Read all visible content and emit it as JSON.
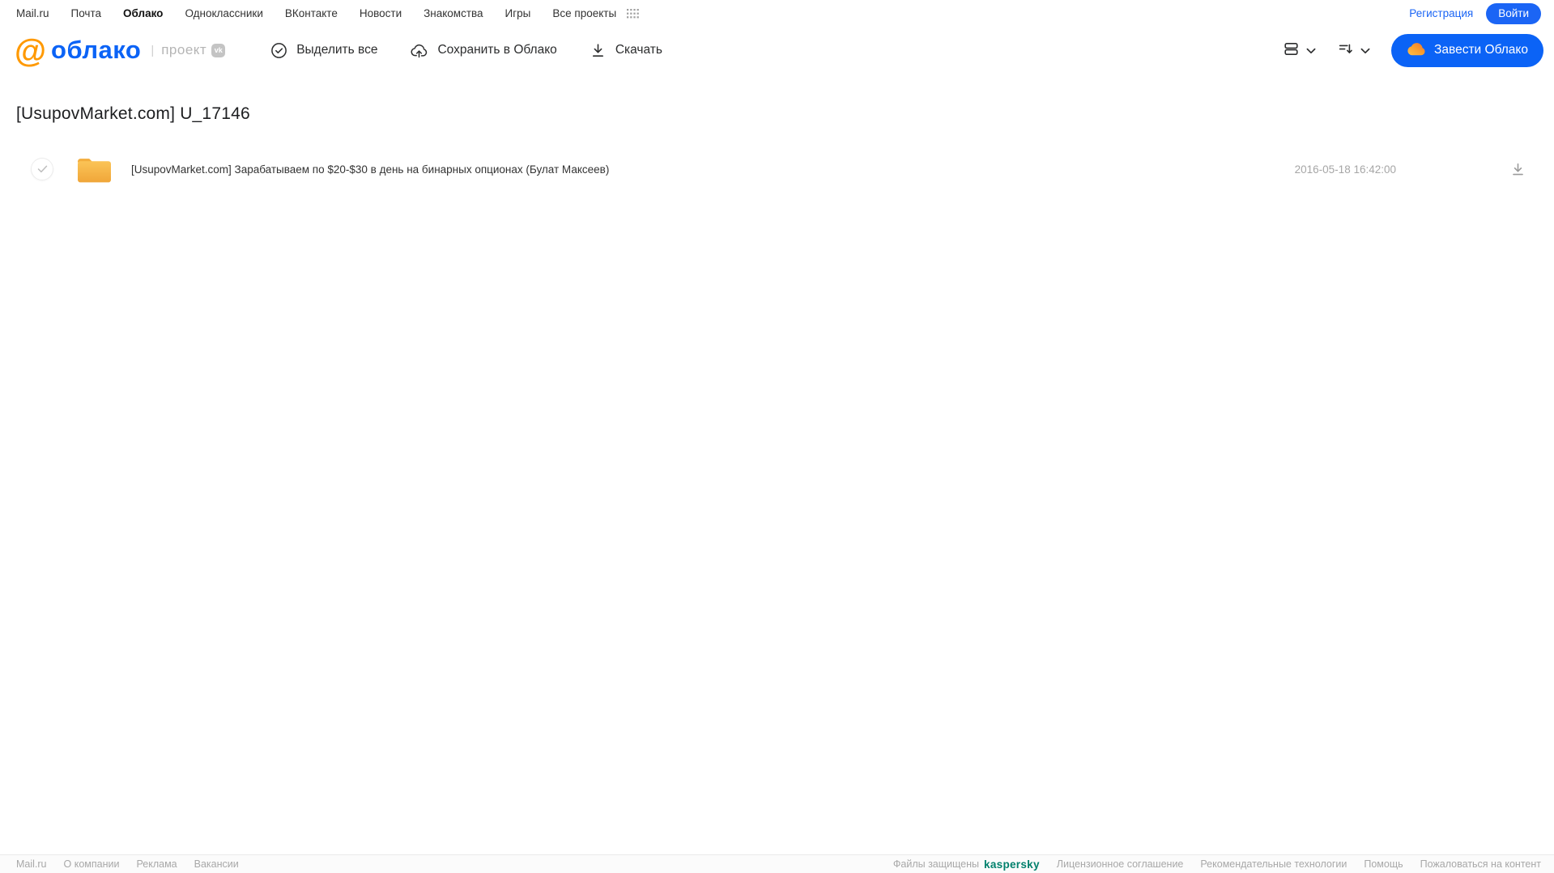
{
  "topnav": {
    "items": [
      "Mail.ru",
      "Почта",
      "Облако",
      "Одноклассники",
      "ВКонтакте",
      "Новости",
      "Знакомства",
      "Игры",
      "Все проекты"
    ],
    "active_item": "Облако",
    "registration_label": "Регистрация",
    "login_label": "Войти"
  },
  "header": {
    "logo_at": "@",
    "logo_text": "облако",
    "project_label": "проект",
    "vk_badge": "vk",
    "toolbar": {
      "select_all_label": "Выделить все",
      "save_to_cloud_label": "Сохранить в Облако",
      "download_label": "Скачать"
    },
    "get_cloud_label": "Завести Облако"
  },
  "main": {
    "title": "[UsupovMarket.com] U_17146",
    "files": [
      {
        "type": "folder",
        "name": "[UsupovMarket.com] Зарабатываем по $20-$30 в день на бинарных опционах (Булат Максеев)",
        "date": "2016-05-18 16:42:00"
      }
    ]
  },
  "footer": {
    "left_links": [
      "Mail.ru",
      "О компании",
      "Реклама",
      "Вакансии"
    ],
    "protected_label": "Файлы защищены",
    "kaspersky_label": "kaspersky",
    "right_links": [
      "Лицензионное соглашение",
      "Рекомендательные технологии",
      "Помощь",
      "Пожаловаться на контент"
    ]
  },
  "colors": {
    "accent_blue": "#0b63f6",
    "link_blue": "#1b65f5",
    "logo_orange": "#ff9900",
    "folder_yellow": "#f5b13c",
    "kaspersky_teal": "#00806c",
    "text_dark": "#2c2d2e",
    "text_gray": "#a8a8a8"
  }
}
